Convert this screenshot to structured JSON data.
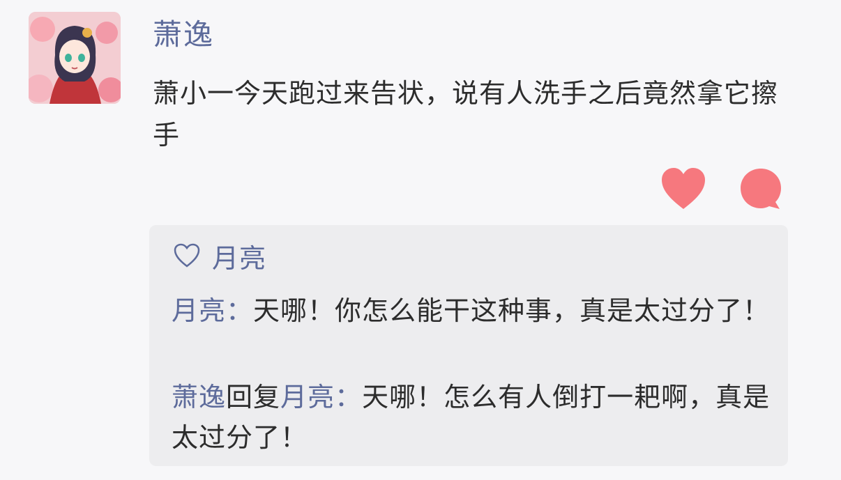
{
  "post": {
    "author": "萧逸",
    "text": "萧小一今天跑过来告状，说有人洗手之后竟然拿它擦手",
    "accent_color": "#5d6b9b",
    "action_color": "#f6787e"
  },
  "actions": {
    "like_icon": "heart-icon",
    "comment_icon": "comment-bubble-icon"
  },
  "replies": {
    "likes": {
      "icon": "heart-outline-icon",
      "users": "月亮"
    },
    "comments": [
      {
        "user": "月亮",
        "separator": "：",
        "text": "天哪！你怎么能干这种事，真是太过分了！"
      },
      {
        "user": "萧逸",
        "reply_word": "回复",
        "target": "月亮",
        "separator": "：",
        "text": "天哪！怎么有人倒打一耙啊，真是太过分了！"
      }
    ]
  }
}
